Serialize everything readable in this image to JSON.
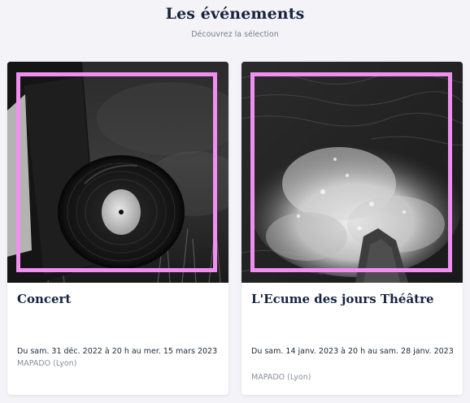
{
  "header": {
    "title": "Les événements",
    "subtitle": "Découvrez la sélection"
  },
  "events": [
    {
      "title": "Concert",
      "dates": "Du sam. 31 déc. 2022 à 20 h au mer. 15 mars 2023",
      "place": "MAPADO (Lyon)",
      "image": "vinyl-record-photo"
    },
    {
      "title": "L'Ecume des jours Théâtre",
      "dates": "Du sam. 14 janv. 2023 à 20 h au sam. 28 janv. 2023",
      "place": "MAPADO (Lyon)",
      "image": "ocean-waves-photo"
    }
  ],
  "colors": {
    "background": "#f4f3f8",
    "heading": "#17233f",
    "muted": "#8a8e9a",
    "frame_accent": "#f08ff0",
    "card": "#ffffff"
  }
}
